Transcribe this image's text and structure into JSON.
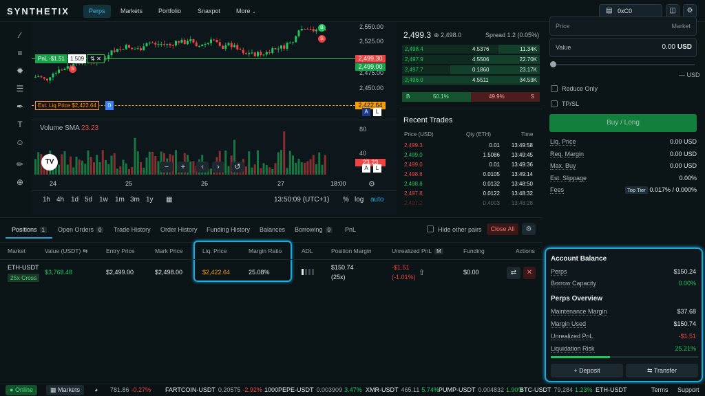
{
  "header": {
    "logo": "SYNTHETIX",
    "nav": [
      "Perps",
      "Markets",
      "Portfolio",
      "Snaxpot",
      "More"
    ],
    "wallet": "0xC0"
  },
  "chart": {
    "pnl_label": "PnL -$1.51",
    "pnl_size": "1.509",
    "liq_label": "Est. Liq Price $2,422.64",
    "liq_badge": "0",
    "volume_label": "Volume SMA",
    "volume_value": "23.23",
    "y_ticks": [
      "2,550.00",
      "2,525.00",
      "2,475.00",
      "2,450.00"
    ],
    "price_tag_1": "2,499.30",
    "price_tag_2": "2,499.00",
    "liq_tag": "2,422.64",
    "vol_ticks": [
      "80",
      "40"
    ],
    "vol_tag": "23.23",
    "x_ticks": [
      "24",
      "25",
      "26",
      "27",
      "18:00"
    ],
    "timeframes": [
      "1h",
      "4h",
      "1d",
      "5d",
      "1w",
      "1m",
      "3m",
      "1y"
    ],
    "time": "13:50:09 (UTC+1)",
    "scale_pct": "%",
    "scale_log": "log",
    "scale_auto": "auto"
  },
  "orderbook": {
    "mid": "2,499.3",
    "mark": "2,498.0",
    "spread": "Spread 1.2 (0.05%)",
    "bids": [
      [
        "2,498.4",
        "4.5376",
        "11.34K"
      ],
      [
        "2,497.9",
        "4.5506",
        "22.70K"
      ],
      [
        "2,497.7",
        "0.1860",
        "23.17K"
      ],
      [
        "2,496.0",
        "4.5511",
        "34.53K"
      ]
    ],
    "buy_letter": "B",
    "buy_pct": "50.1%",
    "sell_pct": "49.9%",
    "sell_letter": "S"
  },
  "trades": {
    "title": "Recent Trades",
    "headers": [
      "Price (USD)",
      "Qty (ETH)",
      "Time"
    ],
    "rows": [
      [
        "2,499.3",
        "0.01",
        "13:49:58",
        "red"
      ],
      [
        "2,499.0",
        "1.5086",
        "13:49:45",
        "green"
      ],
      [
        "2,499.0",
        "0.01",
        "13:49:36",
        "red"
      ],
      [
        "2,498.6",
        "0.0105",
        "13:49:14",
        "red"
      ],
      [
        "2,498.8",
        "0.0132",
        "13:48:50",
        "green"
      ],
      [
        "2,497.8",
        "0.0122",
        "13:48:32",
        "red"
      ],
      [
        "2,497.2",
        "0.4003",
        "13:48:28",
        "red"
      ]
    ]
  },
  "order_form": {
    "price_label": "Price",
    "price_market": "Market",
    "value_label": "Value",
    "value_amount": "0.00",
    "value_unit": "USD",
    "slider_unit": "— USD",
    "reduce_only": "Reduce Only",
    "tpsl": "TP/SL",
    "submit": "Buy / Long",
    "info": [
      [
        "Liq. Price",
        "0.00 USD"
      ],
      [
        "Req. Margin",
        "0.00 USD"
      ],
      [
        "Max. Buy",
        "0.00 USD"
      ],
      [
        "Est. Slippage",
        "0.00%"
      ],
      [
        "Fees",
        "0.017% / 0.000%"
      ]
    ],
    "fee_tier": "Top Tier"
  },
  "positions": {
    "tabs": [
      {
        "label": "Positions",
        "count": "1"
      },
      {
        "label": "Open Orders",
        "count": "0"
      },
      {
        "label": "Trade History",
        "count": ""
      },
      {
        "label": "Order History",
        "count": ""
      },
      {
        "label": "Funding History",
        "count": ""
      },
      {
        "label": "Balances",
        "count": ""
      },
      {
        "label": "Borrowing",
        "count": "0"
      },
      {
        "label": "PnL",
        "count": ""
      }
    ],
    "hide_other": "Hide other pairs",
    "close_all": "Close All",
    "headers": [
      "Market",
      "Value (USDT)",
      "Entry Price",
      "Mark Price",
      "Liq. Price",
      "Margin Ratio",
      "ADL",
      "Position Margin",
      "Unrealized PnL",
      "Funding",
      "Actions"
    ],
    "pnl_badge": "M",
    "row": {
      "market": "ETH-USDT",
      "leverage": "25x Cross",
      "value": "$3,768.48",
      "entry": "$2,499.00",
      "mark": "$2,498.00",
      "liq": "$2,422.64",
      "margin_ratio": "25.08%",
      "pos_margin": "$150.74",
      "pos_lev": "(25x)",
      "upnl": "-$1.51",
      "upnl_pct": "(-1.01%)",
      "funding": "$0.00"
    }
  },
  "account": {
    "title": "Account Balance",
    "rows1": [
      [
        "Perps",
        "$150.24"
      ],
      [
        "Borrow Capacity",
        "0.00%"
      ]
    ],
    "overview_title": "Perps Overview",
    "rows2": [
      [
        "Maintenance Margin",
        "$37.68"
      ],
      [
        "Margin Used",
        "$150.74"
      ],
      [
        "Unrealized PnL",
        "-$1.51"
      ],
      [
        "Liquidation Risk",
        "25.21%"
      ]
    ],
    "liq_risk": 0.2521,
    "deposit": "Deposit",
    "transfer": "Transfer"
  },
  "footer": {
    "online": "Online",
    "markets": "Markets",
    "ticker": [
      [
        "",
        "781.86",
        "-0.27%"
      ],
      [
        "FARTCOIN-USDT",
        "0.20575",
        "-2.92%"
      ],
      [
        "1000PEPE-USDT",
        "0.003909",
        "3.47%"
      ],
      [
        "XMR-USDT",
        "465.11",
        "5.74%"
      ],
      [
        "PUMP-USDT",
        "0.004832",
        "1.90%"
      ],
      [
        "BTC-USDT",
        "79,284",
        "1.23%"
      ],
      [
        "ETH-USDT",
        "",
        ""
      ]
    ],
    "terms": "Terms",
    "support": "Support"
  },
  "colors": {
    "accent": "#1fa8d9",
    "green": "#22c55e",
    "red": "#ef4444",
    "orange": "#f59e0b"
  }
}
